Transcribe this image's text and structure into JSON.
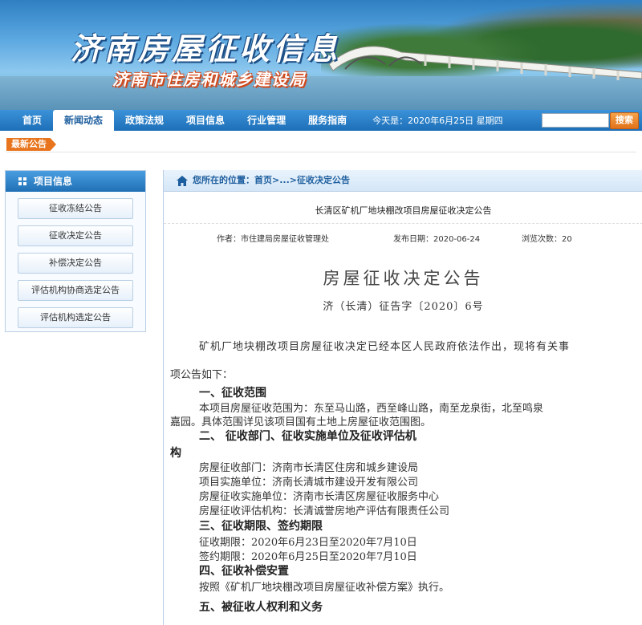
{
  "header": {
    "title": "济南房屋征收信息",
    "subtitle": "济南市住房和城乡建设局"
  },
  "nav": {
    "items": [
      "首页",
      "新闻动态",
      "政策法规",
      "项目信息",
      "行业管理",
      "服务指南"
    ],
    "active_index": 1,
    "date_text": "今天是：2020年6月25日  星期四",
    "search_value": "",
    "search_button": "搜索"
  },
  "latest": {
    "label": "最新公告"
  },
  "sidebar": {
    "title": "项目信息",
    "items": [
      "征收冻结公告",
      "征收决定公告",
      "补偿决定公告",
      "评估机构协商选定公告",
      "评估机构选定公告"
    ]
  },
  "breadcrumb": {
    "prefix": "您所在的位置：",
    "home": "首页",
    "sep": ">...>",
    "current": "征收决定公告"
  },
  "article": {
    "heading": "长清区矿机厂地块棚改项目房屋征收决定公告",
    "author": "作者：市住建局房屋征收管理处",
    "date": "发布日期：2020-06-24",
    "views": "浏览次数：20",
    "doc_title": "房屋征收决定公告",
    "doc_number": "济（长清）征告字〔2020〕6号",
    "intro_line1": "矿机厂地块棚改项目房屋征收决定已经本区人民政府依法作出，现将有关事",
    "intro_line2": "项公告如下：",
    "s1_title": "一、征收范围",
    "s1_l1": "本项目房屋征收范围为：东至马山路，西至峰山路，南至龙泉街，北至鸣泉",
    "s1_l2": "嘉园。具体范围详见该项目国有土地上房屋征收范围图。",
    "s2_title_a": "二、  征收部门、征收实施单位及征收评估机",
    "s2_title_b": "构",
    "s2_l1": "房屋征收部门：济南市长清区住房和城乡建设局",
    "s2_l2": "项目实施单位：济南长清城市建设开发有限公司",
    "s2_l3": "房屋征收实施单位：济南市长清区房屋征收服务中心",
    "s2_l4": "房屋征收评估机构：长清诚誉房地产评估有限责任公司",
    "s3_title": "三、征收期限、签约期限",
    "s3_l1": "征收期限：2020年6月23日至2020年7月10日",
    "s3_l2": "签约期限：2020年6月25日至2020年7月10日",
    "s4_title": "四、征收补偿安置",
    "s4_l1": "按照《矿机厂地块棚改项目房屋征收补偿方案》执行。",
    "s5_title": "五、被征收人权利和义务"
  },
  "colors": {
    "nav_blue": "#1d6fb8",
    "accent_orange": "#e8751d",
    "link_blue": "#1d5e9e"
  }
}
